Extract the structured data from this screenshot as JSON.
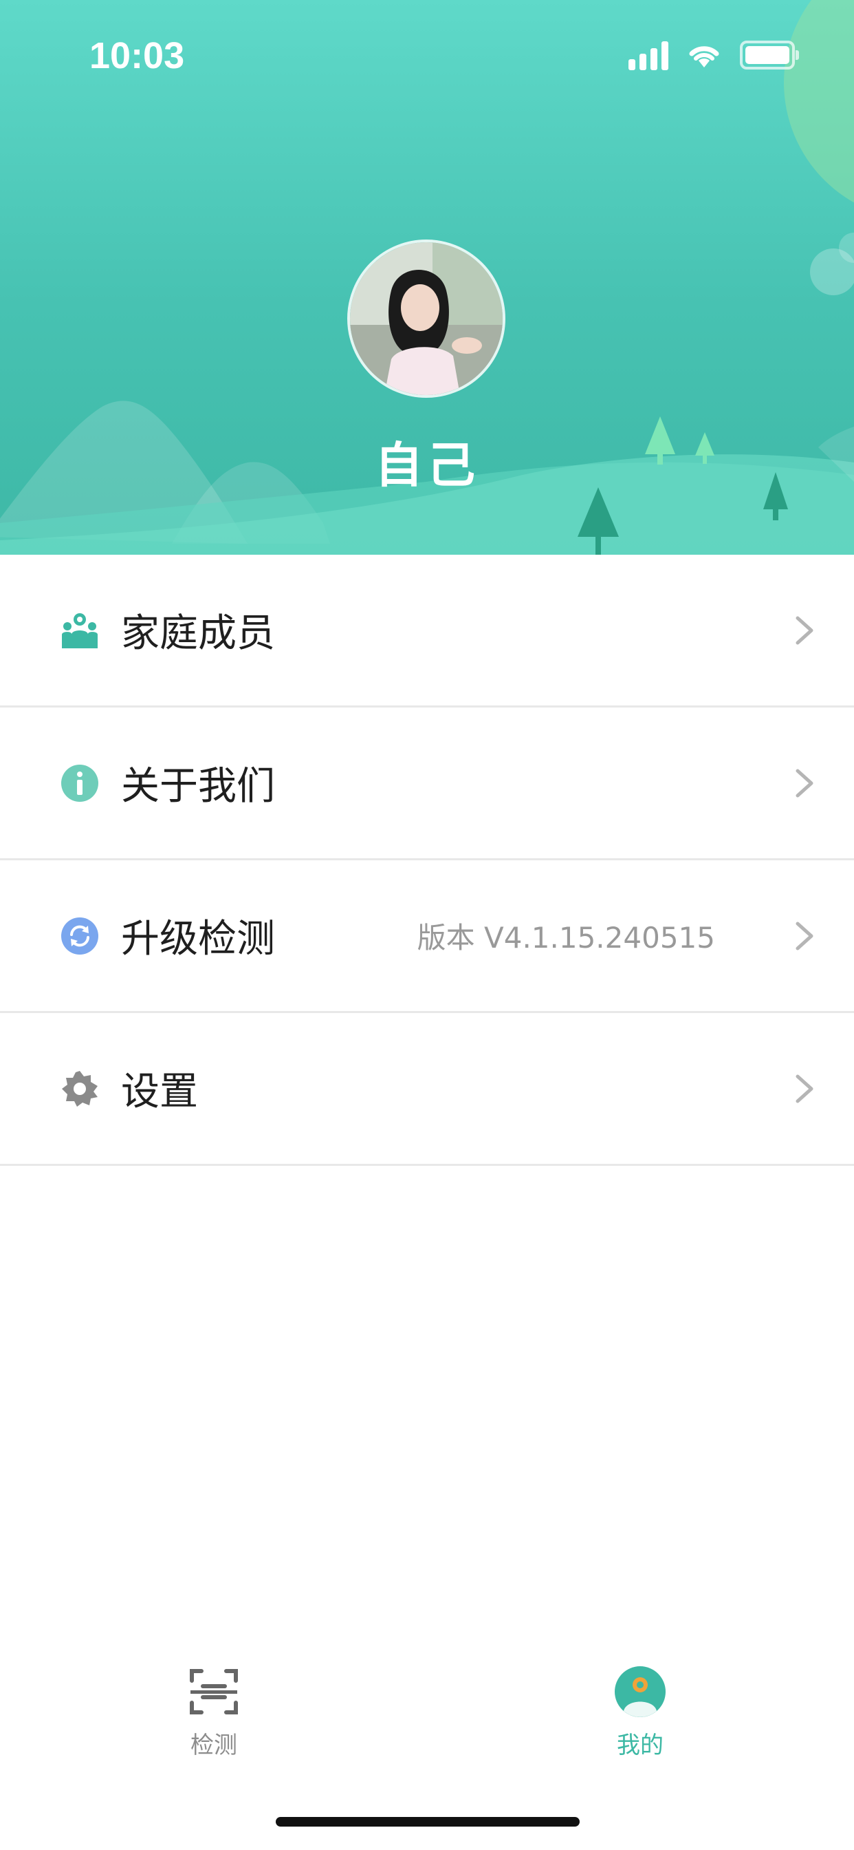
{
  "status_bar": {
    "time": "10:03"
  },
  "profile": {
    "name": "自己"
  },
  "menu": [
    {
      "label": "家庭成员",
      "icon": "family-icon",
      "value": ""
    },
    {
      "label": "关于我们",
      "icon": "info-icon",
      "value": ""
    },
    {
      "label": "升级检测",
      "icon": "refresh-icon",
      "value": "版本 V4.1.15.240515"
    },
    {
      "label": "设置",
      "icon": "gear-icon",
      "value": ""
    }
  ],
  "tabbar": {
    "detect_label": "检测",
    "mine_label": "我的"
  },
  "colors": {
    "accent": "#3cb8a4",
    "header_top": "#5fd9c9",
    "header_bottom": "#3eb8a6",
    "info_icon": "#6ecdb9",
    "refresh_icon": "#7aa6ee",
    "gear_icon": "#8a8a8a",
    "tab_inactive": "#8c8c8c"
  }
}
